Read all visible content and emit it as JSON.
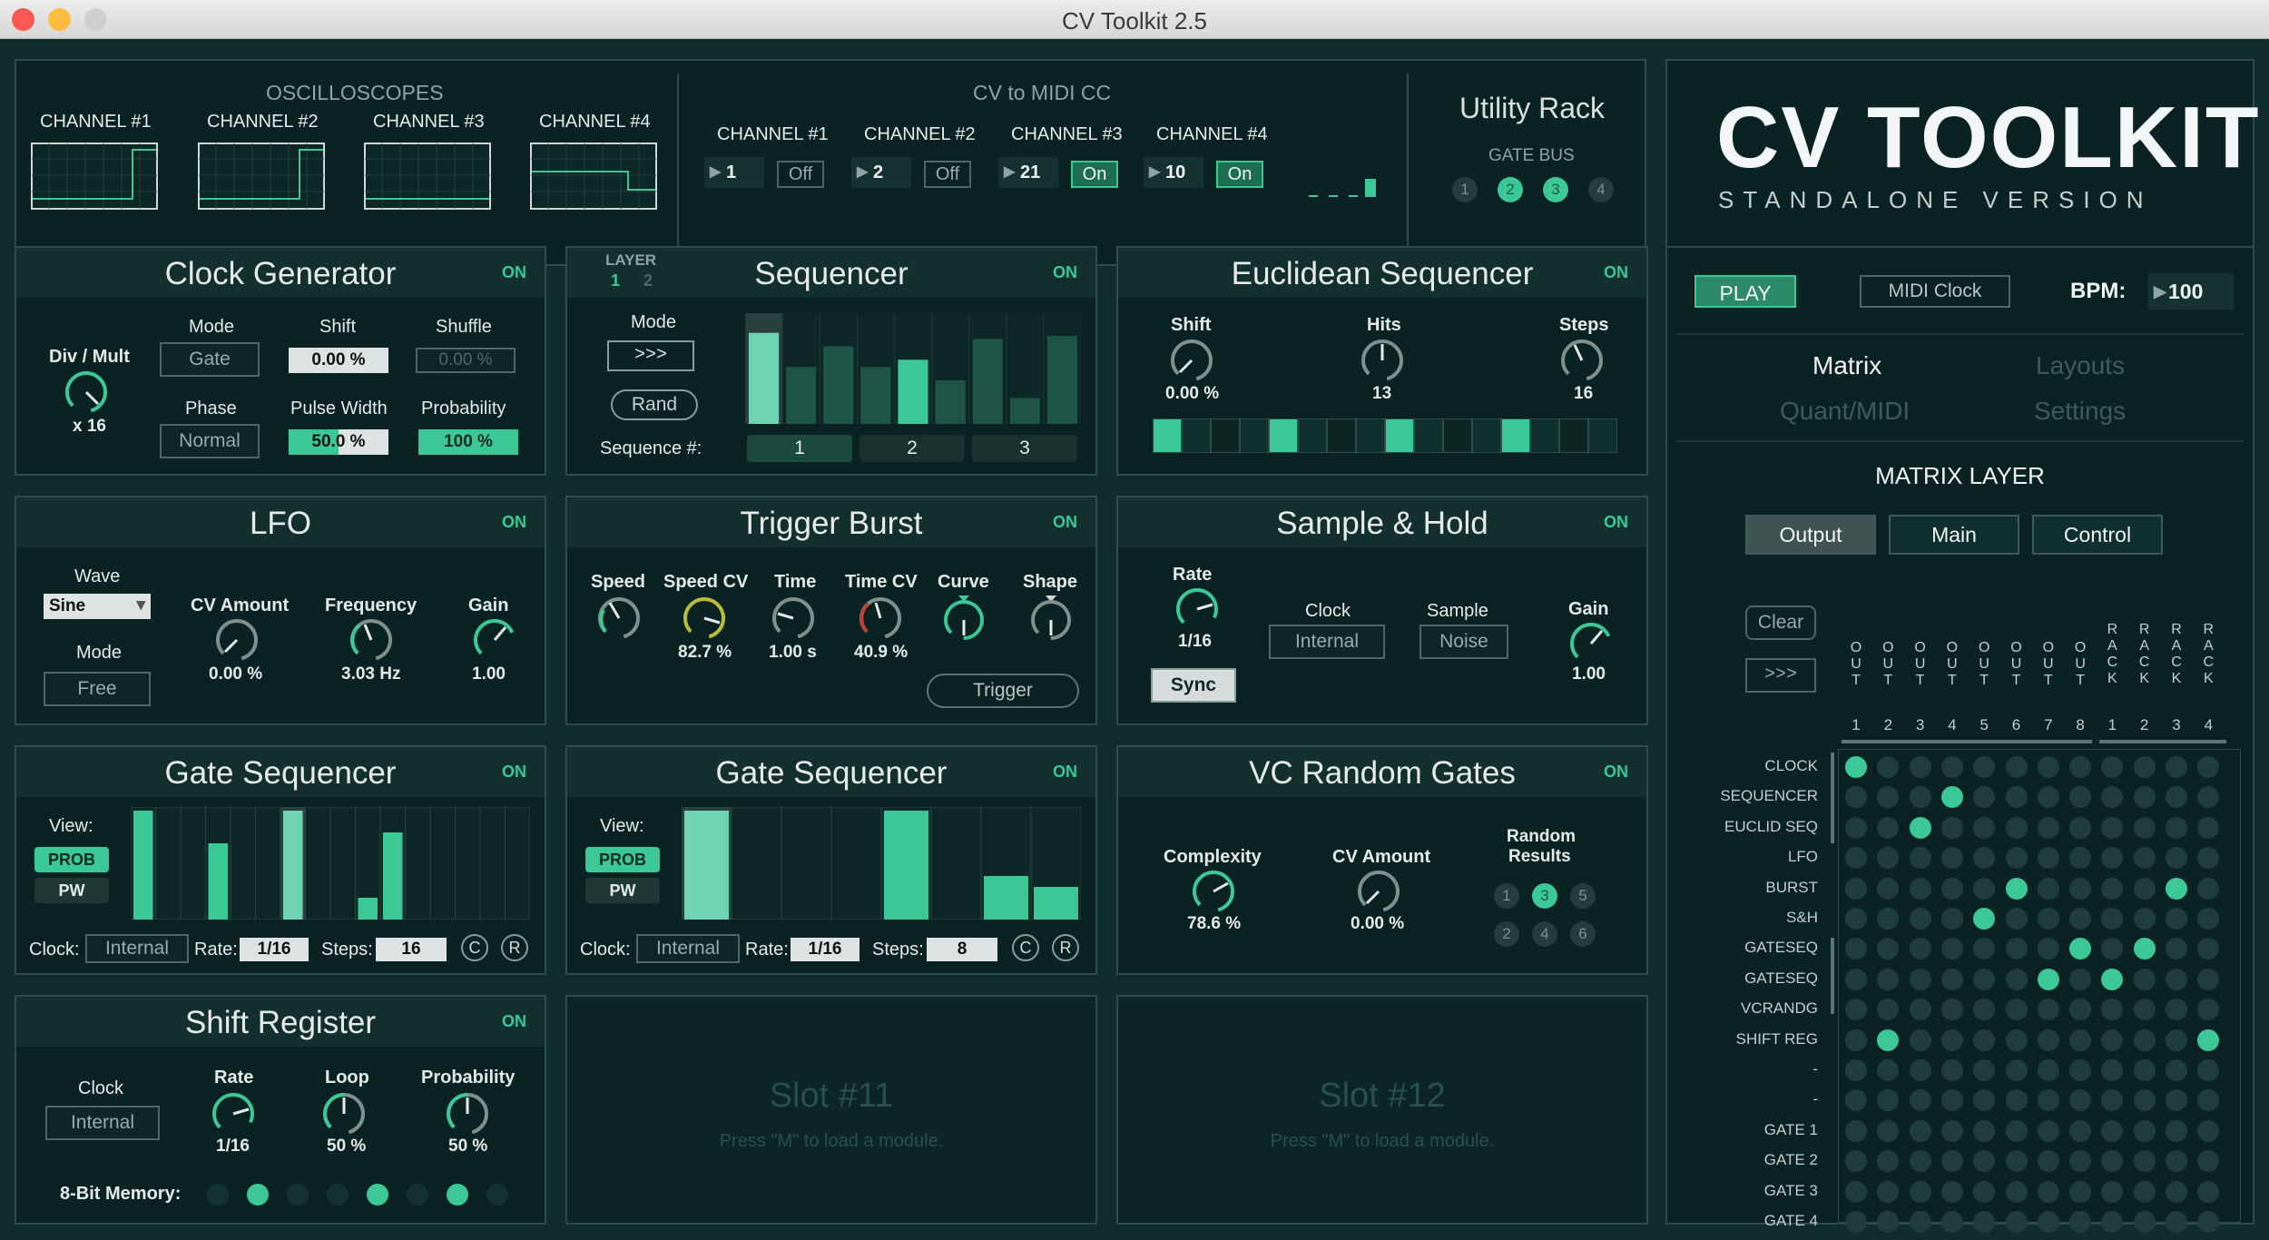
{
  "window": {
    "title": "CV Toolkit 2.5",
    "colors": {
      "close": "#fc5753",
      "minimize": "#fdbc40",
      "zoom": "#cfcfcf",
      "accent": "#3cc896"
    }
  },
  "oscilloscopes": {
    "title": "OSCILLOSCOPES",
    "channels": [
      "CHANNEL #1",
      "CHANNEL #2",
      "CHANNEL #3",
      "CHANNEL #4"
    ]
  },
  "cv_to_midi": {
    "title": "CV to MIDI CC",
    "channels": [
      {
        "label": "CHANNEL #1",
        "cc": "1",
        "state": "Off"
      },
      {
        "label": "CHANNEL #2",
        "cc": "2",
        "state": "Off"
      },
      {
        "label": "CHANNEL #3",
        "cc": "21",
        "state": "On"
      },
      {
        "label": "CHANNEL #4",
        "cc": "10",
        "state": "On"
      }
    ]
  },
  "utility_rack": {
    "title": "Utility Rack",
    "gate_bus_label": "GATE BUS",
    "gates": [
      {
        "n": "1",
        "on": false
      },
      {
        "n": "2",
        "on": true
      },
      {
        "n": "3",
        "on": true
      },
      {
        "n": "4",
        "on": false
      }
    ]
  },
  "logo": {
    "title": "CV TOOLKIT",
    "subtitle": "STANDALONE VERSION"
  },
  "clock_generator": {
    "title": "Clock Generator",
    "on": "ON",
    "div_label": "Div / Mult",
    "div_value": "x 16",
    "mode_label": "Mode",
    "mode_value": "Gate",
    "shift_label": "Shift",
    "shift_value": "0.00 %",
    "shuffle_label": "Shuffle",
    "shuffle_value": "0.00 %",
    "phase_label": "Phase",
    "phase_value": "Normal",
    "pw_label": "Pulse Width",
    "pw_value": "50.0 %",
    "prob_label": "Probability",
    "prob_value": "100 %",
    "pw_fill": 0.5
  },
  "sequencer": {
    "title": "Sequencer",
    "on": "ON",
    "layer_label": "LAYER",
    "layers": [
      "1",
      "2"
    ],
    "mode_label": "Mode",
    "mode_value": ">>>",
    "rand_label": "Rand",
    "seq_label": "Sequence #:",
    "seq_buttons": [
      "1",
      "2",
      "3"
    ],
    "bars": [
      0.88,
      0.55,
      0.75,
      0.55,
      0.62,
      0.42,
      0.82,
      0.25,
      0.85
    ],
    "highlight_bar": 4
  },
  "euclidean": {
    "title": "Euclidean Sequencer",
    "on": "ON",
    "shift_label": "Shift",
    "shift_value": "0.00 %",
    "hits_label": "Hits",
    "hits_value": "13",
    "steps_label": "Steps",
    "steps_value": "16",
    "steps": [
      1,
      0,
      0,
      0,
      1,
      0,
      0,
      0,
      1,
      0,
      0,
      0,
      1,
      0,
      0,
      0
    ]
  },
  "lfo": {
    "title": "LFO",
    "on": "ON",
    "wave_label": "Wave",
    "wave_value": "Sine",
    "mode_label": "Mode",
    "mode_value": "Free",
    "cv_label": "CV Amount",
    "cv_value": "0.00 %",
    "freq_label": "Frequency",
    "freq_value": "3.03 Hz",
    "gain_label": "Gain",
    "gain_value": "1.00"
  },
  "trigger_burst": {
    "title": "Trigger Burst",
    "on": "ON",
    "speed_label": "Speed",
    "speedcv_label": "Speed CV",
    "speedcv_value": "82.7 %",
    "time_label": "Time",
    "time_value": "1.00 s",
    "timecv_label": "Time CV",
    "timecv_value": "40.9 %",
    "curve_label": "Curve",
    "shape_label": "Shape",
    "trigger_label": "Trigger"
  },
  "sample_hold": {
    "title": "Sample & Hold",
    "on": "ON",
    "rate_label": "Rate",
    "rate_value": "1/16",
    "clock_label": "Clock",
    "clock_value": "Internal",
    "sample_label": "Sample",
    "sample_value": "Noise",
    "gain_label": "Gain",
    "gain_value": "1.00",
    "sync_label": "Sync"
  },
  "gate_seq1": {
    "title": "Gate Sequencer",
    "on": "ON",
    "view_label": "View:",
    "prob_label": "PROB",
    "pw_label": "PW",
    "clock_label": "Clock:",
    "clock_value": "Internal",
    "rate_label": "Rate:",
    "rate_value": "1/16",
    "steps_label": "Steps:",
    "steps_value": "16",
    "c_label": "C",
    "r_label": "R",
    "bars": [
      1,
      0,
      0,
      0.7,
      0,
      0,
      1.0,
      0,
      0,
      0.2,
      0.8,
      0,
      0,
      0,
      0,
      0
    ],
    "hl": 6
  },
  "gate_seq2": {
    "title": "Gate Sequencer",
    "on": "ON",
    "view_label": "View:",
    "prob_label": "PROB",
    "pw_label": "PW",
    "clock_label": "Clock:",
    "clock_value": "Internal",
    "rate_label": "Rate:",
    "rate_value": "1/16",
    "steps_label": "Steps:",
    "steps_value": "8",
    "c_label": "C",
    "r_label": "R",
    "bars": [
      1,
      0,
      0,
      0,
      1,
      0,
      0.4,
      0.3
    ],
    "hl": 0
  },
  "vc_random": {
    "title": "VC Random Gates",
    "on": "ON",
    "complexity_label": "Complexity",
    "complexity_value": "78.6 %",
    "cv_label": "CV Amount",
    "cv_value": "0.00 %",
    "results_label": "Random",
    "results_label2": "Results",
    "results": [
      "1",
      "3",
      "5",
      "2",
      "4",
      "6"
    ]
  },
  "shift_register": {
    "title": "Shift Register",
    "on": "ON",
    "clock_label": "Clock",
    "clock_value": "Internal",
    "rate_label": "Rate",
    "rate_value": "1/16",
    "loop_label": "Loop",
    "loop_value": "50 %",
    "prob_label": "Probability",
    "prob_value": "50 %",
    "memory_label": "8-Bit Memory:",
    "memory": [
      0,
      1,
      0,
      0,
      1,
      0,
      1,
      0
    ]
  },
  "slot11": {
    "title": "Slot #11",
    "hint": "Press \"M\" to load a module."
  },
  "slot12": {
    "title": "Slot #12",
    "hint": "Press \"M\" to load a module."
  },
  "transport": {
    "play": "PLAY",
    "midi_clock": "MIDI Clock",
    "bpm_label": "BPM:",
    "bpm_value": "100"
  },
  "nav": {
    "matrix": "Matrix",
    "layouts": "Layouts",
    "quant": "Quant/MIDI",
    "settings": "Settings"
  },
  "matrix": {
    "layer_title": "MATRIX LAYER",
    "tabs": [
      "Output",
      "Main",
      "Control"
    ],
    "clear": "Clear",
    "mode": ">>>",
    "col_groups": [
      {
        "letters": [
          "O",
          "U",
          "T"
        ],
        "nums": [
          "1",
          "2",
          "3",
          "4",
          "5",
          "6",
          "7",
          "8"
        ]
      },
      {
        "letters": [
          "R",
          "A",
          "C",
          "K"
        ],
        "nums": [
          "1",
          "2",
          "3",
          "4"
        ]
      }
    ],
    "rows": [
      "CLOCK",
      "SEQUENCER",
      "EUCLID SEQ",
      "LFO",
      "BURST",
      "S&H",
      "GATESEQ",
      "GATESEQ",
      "VCRANDG",
      "SHIFT REG",
      "-",
      "-",
      "GATE 1",
      "GATE 2",
      "GATE 3",
      "GATE 4"
    ],
    "active": [
      [
        0,
        0
      ],
      [
        1,
        3
      ],
      [
        2,
        2
      ],
      [
        4,
        5
      ],
      [
        4,
        10
      ],
      [
        5,
        4
      ],
      [
        6,
        7
      ],
      [
        6,
        9
      ],
      [
        7,
        6
      ],
      [
        7,
        8
      ],
      [
        9,
        1
      ],
      [
        9,
        11
      ]
    ]
  }
}
